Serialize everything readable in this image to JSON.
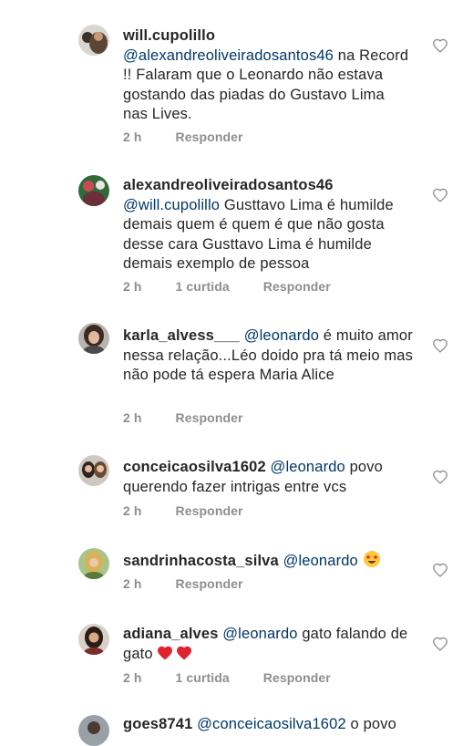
{
  "comments": [
    {
      "username": "will.cupolillo",
      "mention": "@alexandreoliveiradosantos46",
      "text": "na Record !! Falaram que o Leonardo não estava gostando das piadas do Gustavo Lima nas Lives.",
      "time": "2 h",
      "reply_label": "Responder"
    },
    {
      "username": "alexandreoliveiradosantos46",
      "mention": "@will.cupolillo",
      "text": "Gusttavo Lima é humilde demais quem é quem é que não gosta desse cara Gusttavo Lima é humilde demais exemplo de pessoa",
      "time": "2 h",
      "likes": "1 curtida",
      "reply_label": "Responder"
    },
    {
      "username": "karla_alvess___",
      "mention": "@leonardo",
      "text": "é muito amor nessa relação...Léo doido pra tá meio mas não pode tá espera Maria Alice",
      "time": "2 h",
      "reply_label": "Responder"
    },
    {
      "username": "conceicaosilva1602",
      "mention": "@leonardo",
      "text": "povo querendo fazer intrigas entre vcs",
      "time": "2 h",
      "reply_label": "Responder"
    },
    {
      "username": "sandrinhacosta_silva",
      "mention": "@leonardo",
      "text": "",
      "emoji": "star-struck-emoji",
      "time": "2 h",
      "reply_label": "Responder"
    },
    {
      "username": "adiana_alves",
      "mention": "@leonardo",
      "text": "gato falando de gato",
      "emoji": "two-red-hearts-emoji",
      "time": "2 h",
      "likes": "1 curtida",
      "reply_label": "Responder"
    },
    {
      "username": "goes8741",
      "mention": "@conceicaosilva1602",
      "text": "o povo"
    }
  ],
  "icons": {
    "like": "heart-outline-icon"
  },
  "colors": {
    "text": "#262626",
    "mention": "#00376b",
    "meta": "#8e8e8e",
    "emoji_heart": "#e0242f",
    "emoji_face": "#ffc83d"
  }
}
